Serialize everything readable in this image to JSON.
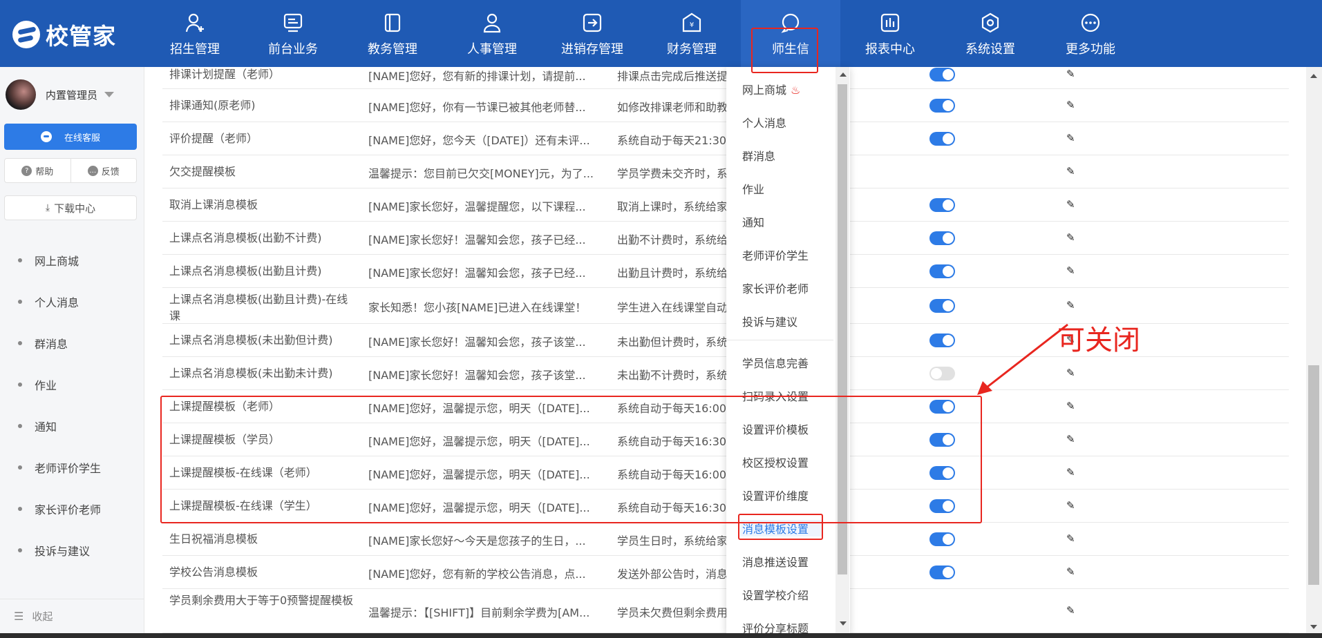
{
  "app": {
    "logo_text": "校管家"
  },
  "nav": [
    {
      "label": "招生管理",
      "icon": "user-plus-icon"
    },
    {
      "label": "前台业务",
      "icon": "monitor-icon"
    },
    {
      "label": "教务管理",
      "icon": "book-icon"
    },
    {
      "label": "人事管理",
      "icon": "person-icon"
    },
    {
      "label": "进销存管理",
      "icon": "arrow-box-icon"
    },
    {
      "label": "财务管理",
      "icon": "yen-house-icon"
    },
    {
      "label": "师生信",
      "icon": "chat-icon",
      "active": true
    },
    {
      "label": "报表中心",
      "icon": "bar-chart-icon"
    },
    {
      "label": "系统设置",
      "icon": "hexagon-gear-icon"
    },
    {
      "label": "更多功能",
      "icon": "more-dots-icon"
    }
  ],
  "sidebar": {
    "username": "内置管理员",
    "service_label": "在线客服",
    "help_label": "帮助",
    "feedback_label": "反馈",
    "download_label": "下载中心",
    "items": [
      "网上商城",
      "个人消息",
      "群消息",
      "作业",
      "通知",
      "老师评价学生",
      "家长评价老师",
      "投诉与建议"
    ],
    "collapse_label": "收起"
  },
  "table": {
    "rows": [
      {
        "name": "排课计划提醒（老师）",
        "content": "[NAME]您好，您有新的排课计划，请提前...",
        "desc": "排课点击完成后推送提醒",
        "enabled": true
      },
      {
        "name": "排课通知(原老师)",
        "content": "[NAME]您好，你有一节课已被其他老师替...",
        "desc": "如修改排课老师和助教",
        "enabled": true
      },
      {
        "name": "评价提醒（老师）",
        "content": "[NAME]您好，您今天（[DATE]）还有未评...",
        "desc": "系统自动于每天21:30",
        "enabled": true
      },
      {
        "name": "欠交提醒模板",
        "content": "温馨提示：您目前已欠交[MONEY]元，为了...",
        "desc": "学员学费未交齐时，系统",
        "enabled": null
      },
      {
        "name": "取消上课消息模板",
        "content": "[NAME]家长您好，温馨提醒您，以下课程...",
        "desc": "取消上课时，系统给家长",
        "enabled": true
      },
      {
        "name": "上课点名消息模板(出勤不计费)",
        "content": "[NAME]家长您好！温馨知会您，孩子已经...",
        "desc": "出勤不计费时，系统给家",
        "enabled": true
      },
      {
        "name": "上课点名消息模板(出勤且计费)",
        "content": "[NAME]家长您好！温馨知会您，孩子已经...",
        "desc": "出勤且计费时，系统给家",
        "enabled": true
      },
      {
        "name": "上课点名消息模板(出勤且计费)-在线课",
        "content": "家长知悉！您小孩[NAME]已进入在线课堂！",
        "desc": "学生进入在线课堂自动",
        "enabled": true
      },
      {
        "name": "上课点名消息模板(未出勤但计费)",
        "content": "[NAME]家长您好！温馨知会您，孩子该堂...",
        "desc": "未出勤但计费时，系统给",
        "enabled": true
      },
      {
        "name": "上课点名消息模板(未出勤未计费)",
        "content": "[NAME]家长您好！温馨知会您，孩子该堂...",
        "desc": "未出勤不计费时，系统给",
        "enabled": false
      },
      {
        "name": "上课提醒模板（老师）",
        "content": "[NAME]您好，温馨提示您，明天（[DATE]...",
        "desc": "系统自动于每天16:00",
        "enabled": true
      },
      {
        "name": "上课提醒模板（学员）",
        "content": "[NAME]您好，温馨提示您，明天（[DATE]...",
        "desc": "系统自动于每天16:30",
        "enabled": true
      },
      {
        "name": "上课提醒模板-在线课（老师）",
        "content": "[NAME]您好，温馨提示您，明天（[DATE]...",
        "desc": "系统自动于每天16:00",
        "enabled": true
      },
      {
        "name": "上课提醒模板-在线课（学生）",
        "content": "[NAME]您好，温馨提示您，明天（[DATE]...",
        "desc": "系统自动于每天16:30",
        "enabled": true
      },
      {
        "name": "生日祝福消息模板",
        "content": "[NAME]家长您好～今天是您孩子的生日，...",
        "desc": "学员生日时，系统给家长",
        "enabled": true
      },
      {
        "name": "学校公告消息模板",
        "content": "[NAME]您好，您有新的学校公告消息，点...",
        "desc": "发送外部公告时，消息",
        "enabled": true
      },
      {
        "name": "学员剩余费用大于等于0预警提醒模板",
        "content": "温馨提示：【[SHIFT]】目前剩余学费为[AM...",
        "desc": "学员未欠费但剩余费用",
        "enabled": null
      }
    ]
  },
  "dropdown": {
    "hot_icon": "flame-icon",
    "items": [
      "网上商城",
      "个人消息",
      "群消息",
      "作业",
      "通知",
      "老师评价学生",
      "家长评价老师",
      "投诉与建议",
      "学员信息完善",
      "扫码录入设置",
      "设置评价模板",
      "校区授权设置",
      "设置评价维度",
      "消息模板设置",
      "消息推送设置",
      "设置学校介绍",
      "评价分享标题"
    ],
    "selected": "消息模板设置"
  },
  "annotation": {
    "text": "可关闭",
    "color": "#e8261f"
  },
  "colors": {
    "header": "#1f5ab4",
    "accent": "#2d7be6",
    "annotation": "#e8261f"
  }
}
